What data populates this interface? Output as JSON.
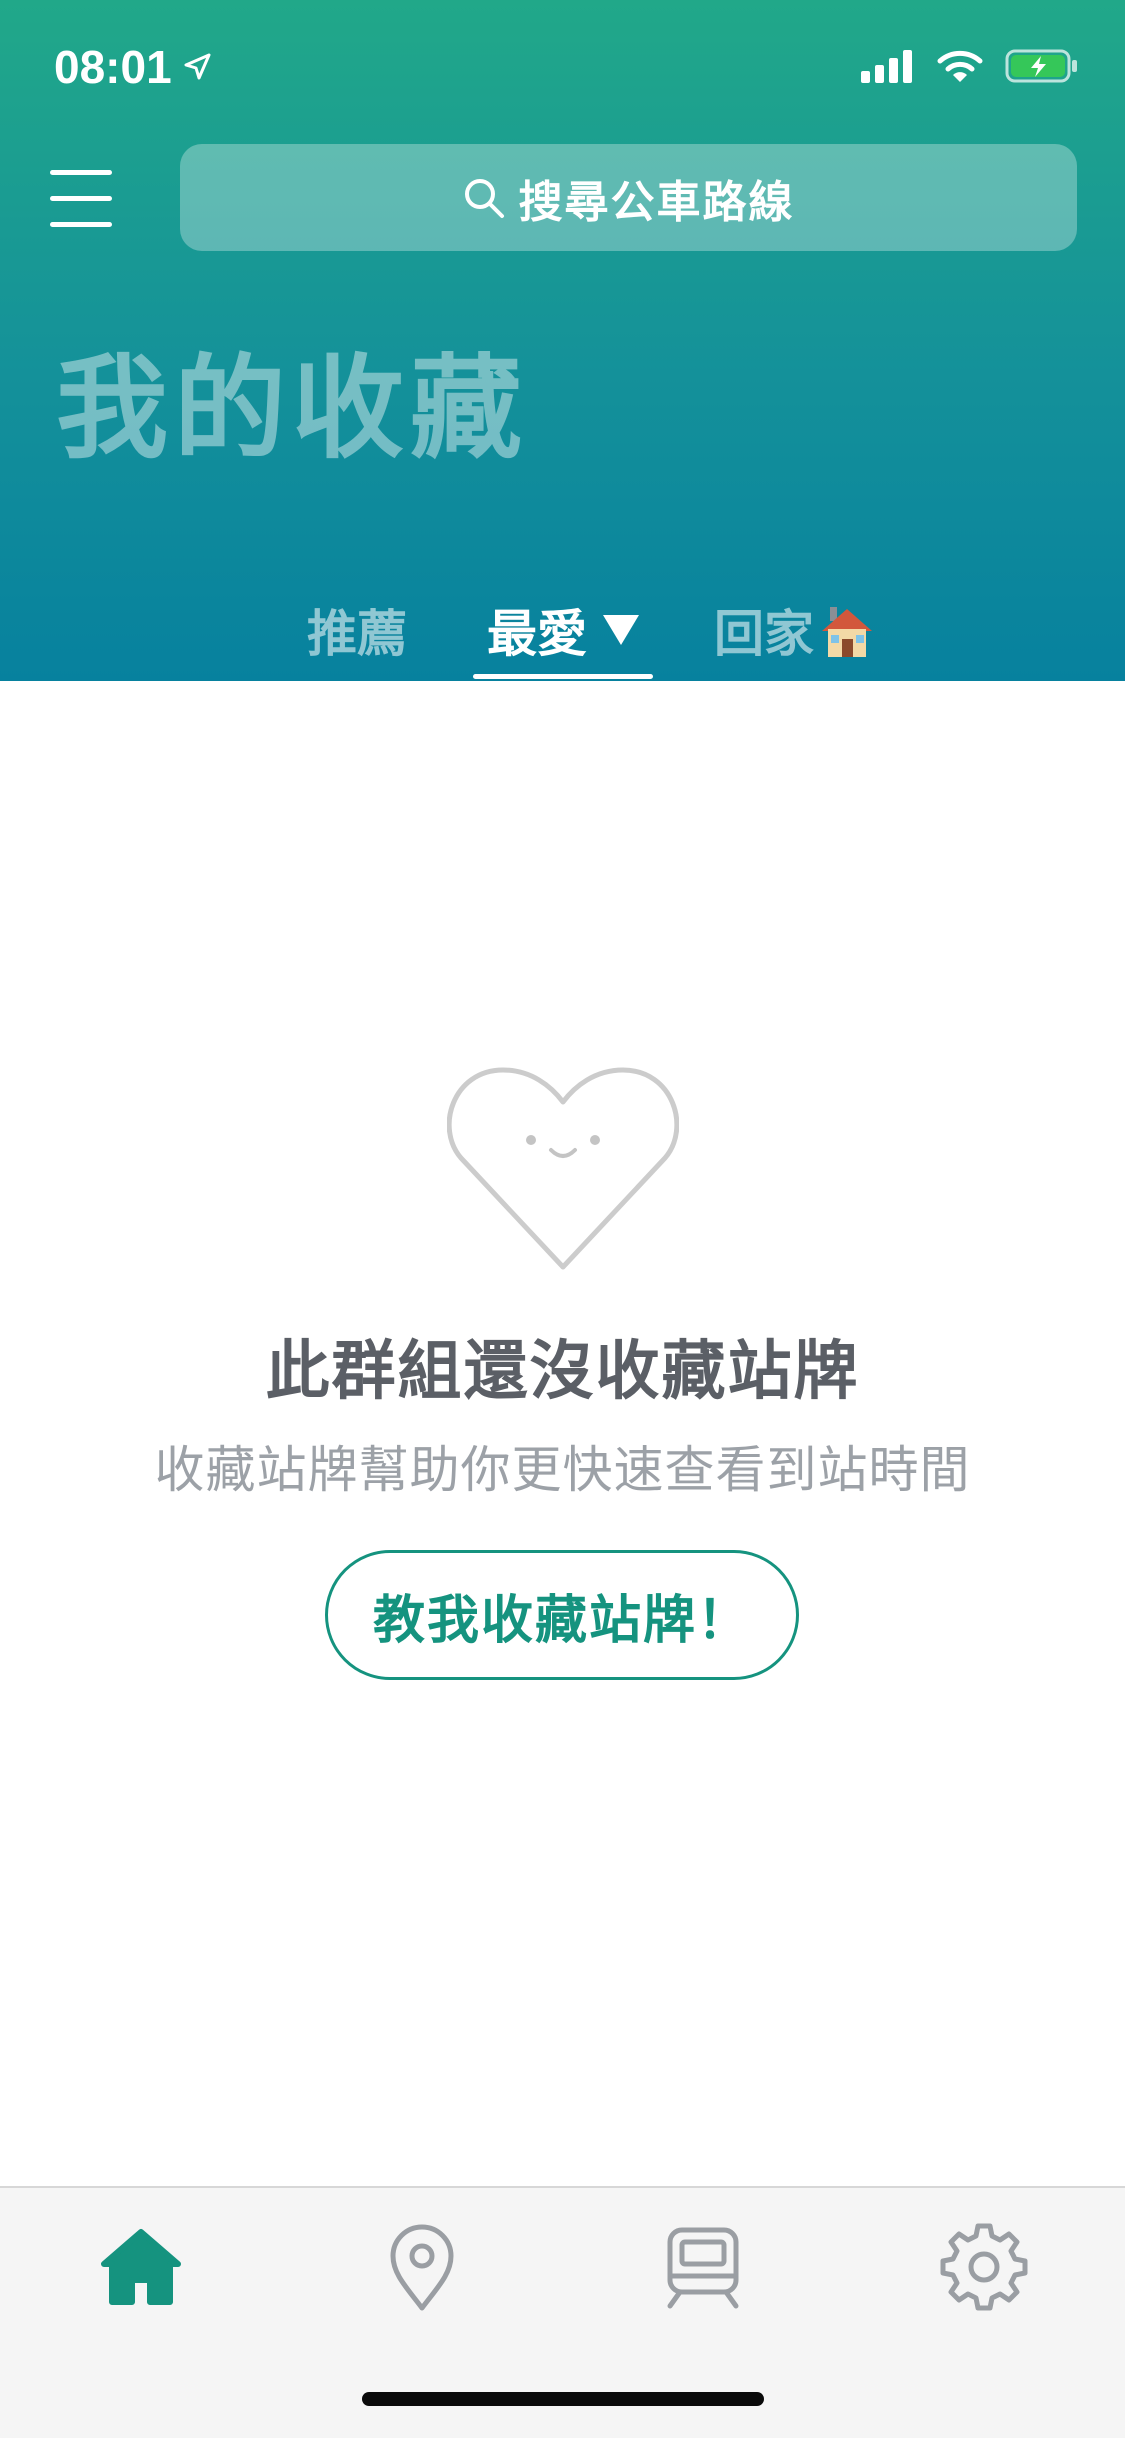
{
  "status_bar": {
    "time": "08:01"
  },
  "search": {
    "label": "搜尋公車路線"
  },
  "page_title": "我的收藏",
  "tabs": [
    {
      "label": "推薦",
      "active": false
    },
    {
      "label": "最愛",
      "active": true
    },
    {
      "label": "回家",
      "active": false
    }
  ],
  "empty_state": {
    "title": "此群組還沒收藏站牌",
    "subtitle": "收藏站牌幫助你更快速查看到站時間",
    "button_label": "教我收藏站牌！"
  },
  "bottom_nav": [
    {
      "icon": "home-icon",
      "active": true
    },
    {
      "icon": "location-pin-icon",
      "active": false
    },
    {
      "icon": "train-icon",
      "active": false
    },
    {
      "icon": "settings-gear-icon",
      "active": false
    }
  ],
  "colors": {
    "header_top": "#21a889",
    "header_bottom": "#07819e",
    "accent": "#15937f",
    "battery": "#35c759"
  }
}
